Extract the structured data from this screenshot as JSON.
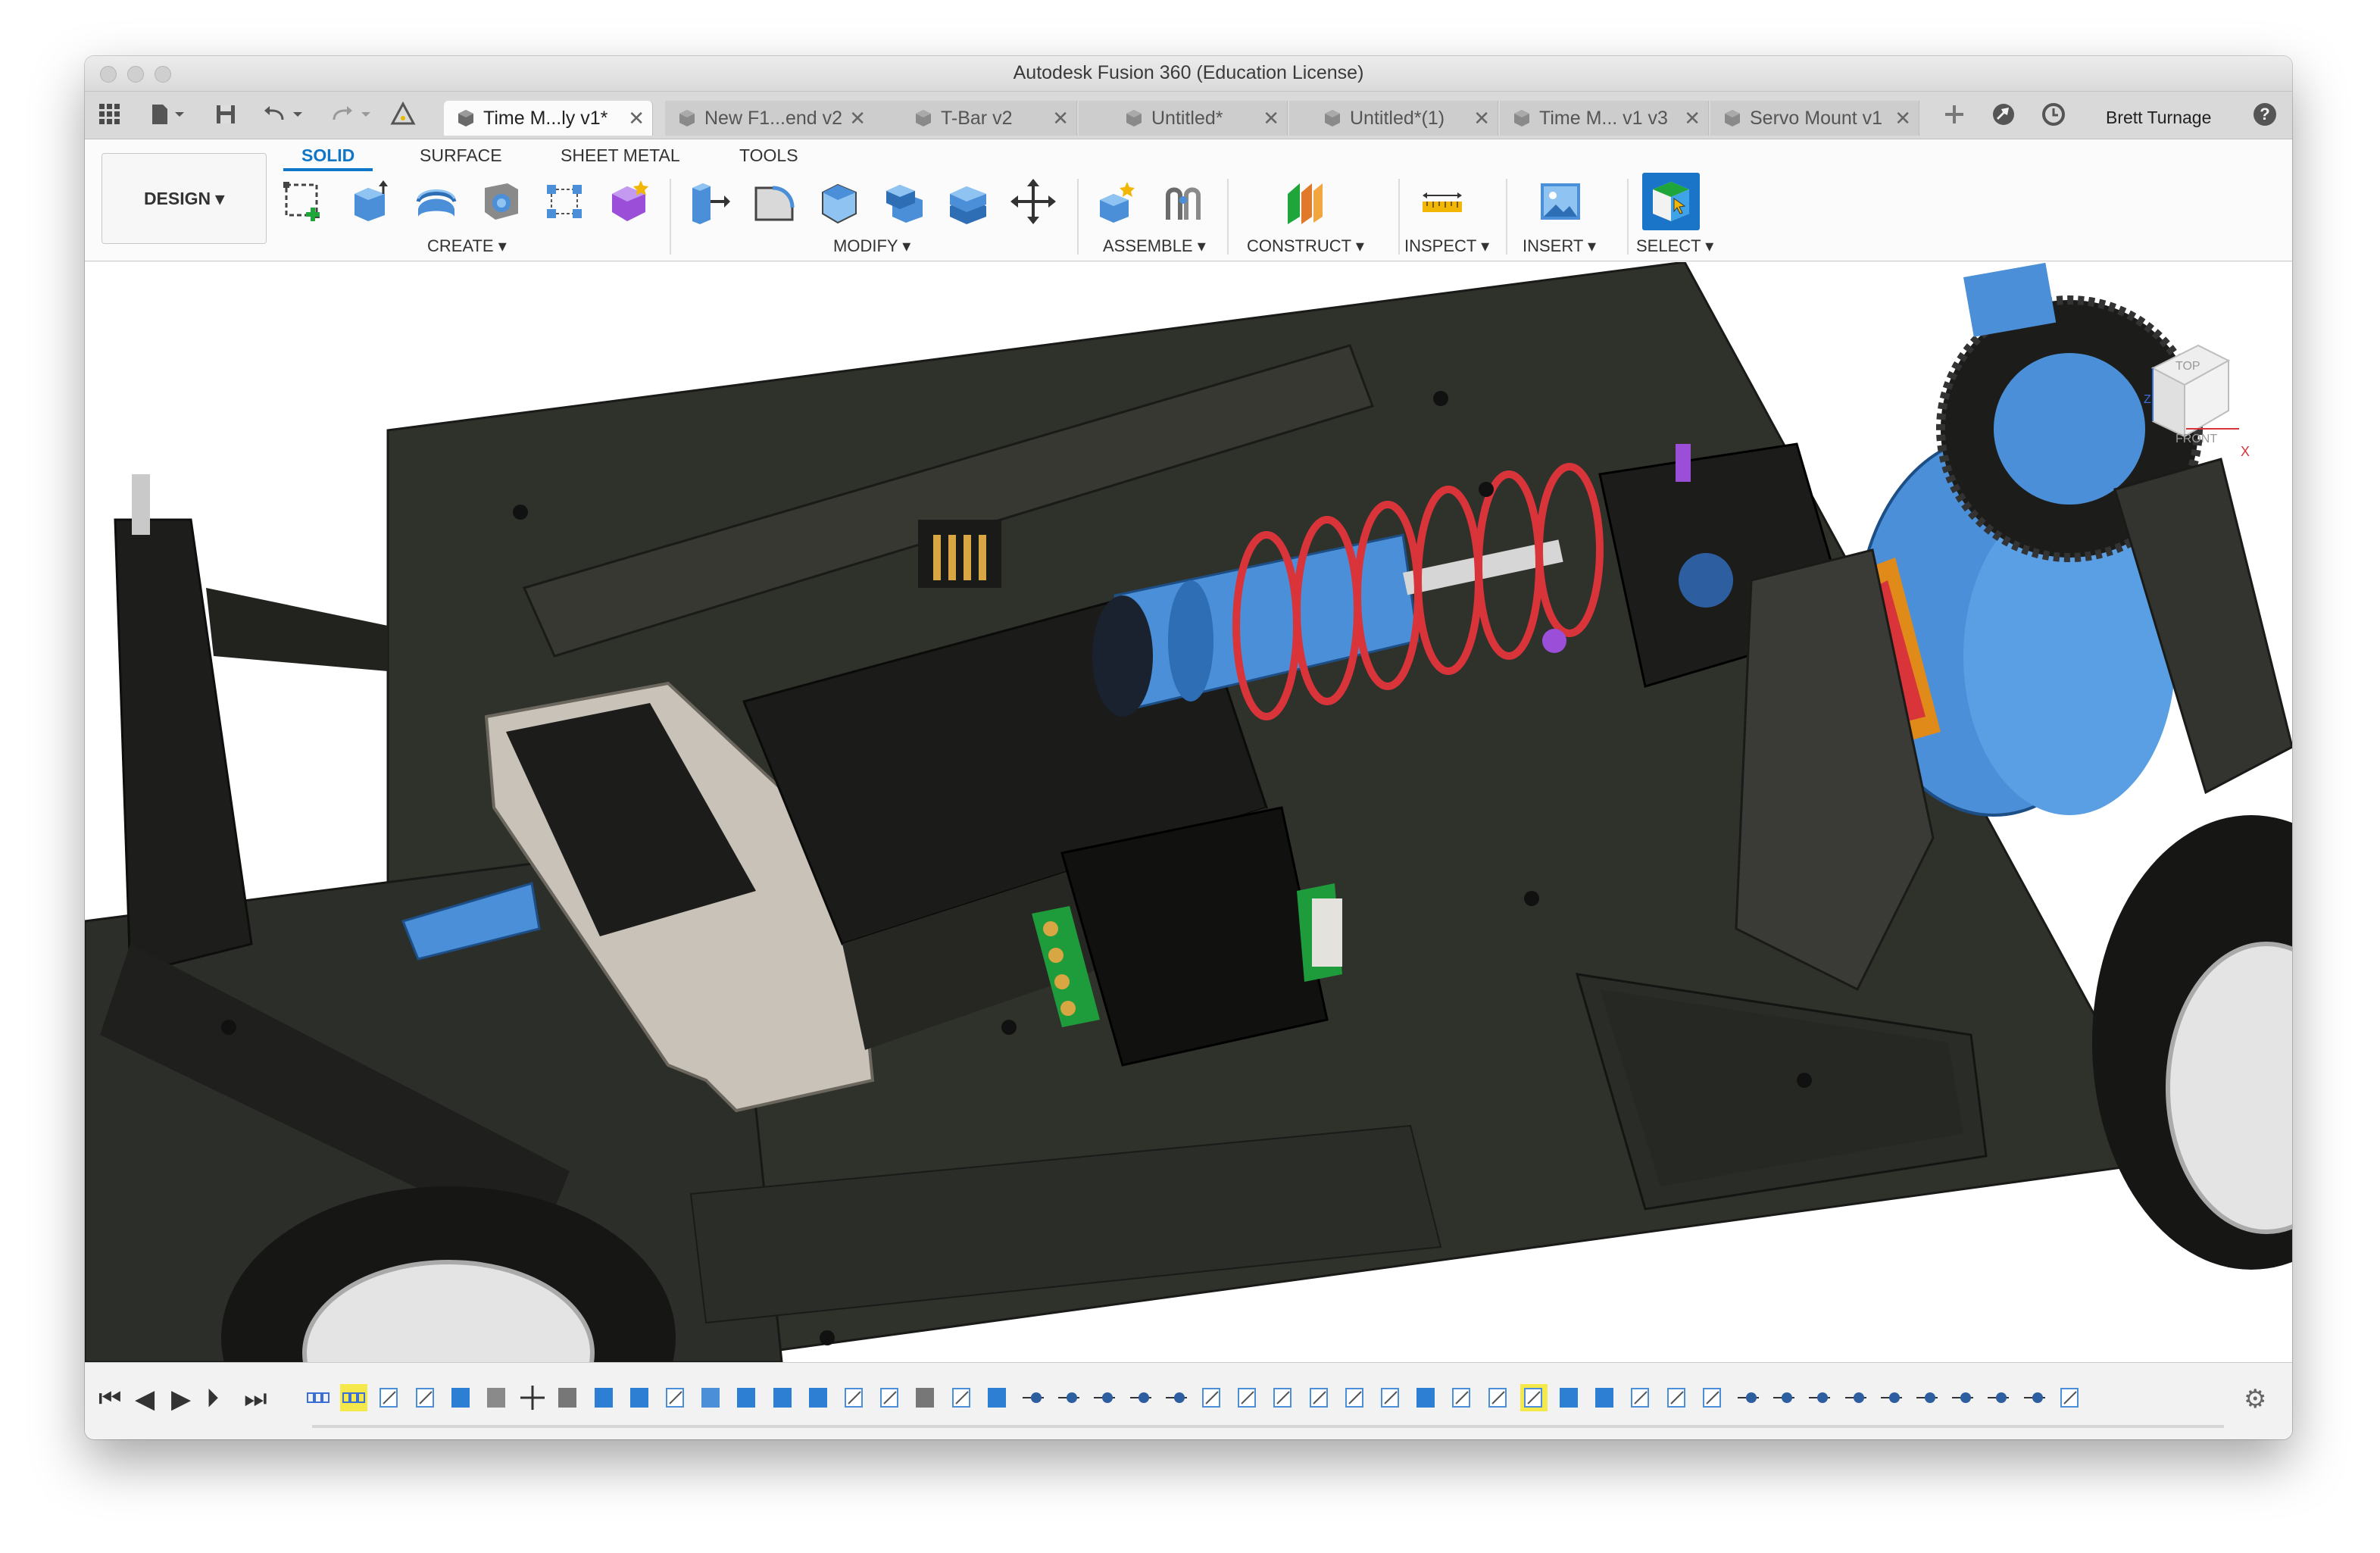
{
  "window": {
    "title": "Autodesk Fusion 360 (Education License)"
  },
  "tabs": [
    {
      "label": "Time M...ly v1*",
      "active": true
    },
    {
      "label": "New F1...end v2",
      "active": false
    },
    {
      "label": "T-Bar v2",
      "active": false
    },
    {
      "label": "Untitled*",
      "active": false
    },
    {
      "label": "Untitled*(1)",
      "active": false
    },
    {
      "label": "Time M... v1 v3",
      "active": false
    },
    {
      "label": "Servo Mount v1",
      "active": false
    }
  ],
  "tab_close": "✕",
  "user": {
    "name": "Brett Turnage"
  },
  "workspace": {
    "label": "DESIGN ▾"
  },
  "workspace_tabs": [
    "SOLID",
    "SURFACE",
    "SHEET METAL",
    "TOOLS"
  ],
  "toolbar_groups": {
    "create": "CREATE ▾",
    "modify": "MODIFY ▾",
    "assemble": "ASSEMBLE ▾",
    "construct": "CONSTRUCT ▾",
    "inspect": "INSPECT ▾",
    "insert": "INSERT ▾",
    "select": "SELECT ▾"
  },
  "viewcube": {
    "top": "TOP",
    "front": "FRONT",
    "x_axis": "X",
    "z_axis": "Z"
  },
  "colors": {
    "accent": "#0f76c8",
    "part_dark": "#2c2e29",
    "part_blue": "#4a8fd8",
    "spring_red": "#d8343a"
  }
}
